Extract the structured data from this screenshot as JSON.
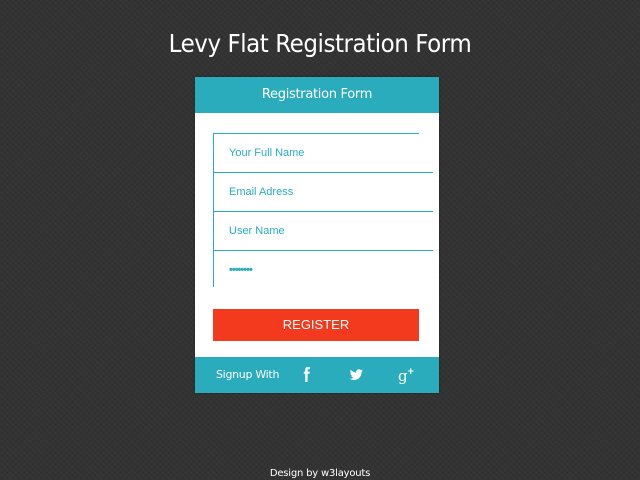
{
  "page": {
    "title": "Levy Flat Registration Form",
    "credit": "Design by w3layouts"
  },
  "form": {
    "header": "Registration Form",
    "fields": [
      {
        "placeholder": "Your Full Name"
      },
      {
        "placeholder": "Email Adress"
      },
      {
        "placeholder": "User Name"
      },
      {
        "value": "••••••••"
      }
    ],
    "register_label": "REGISTER",
    "footer": {
      "signup_label": "Signup With",
      "social": [
        "facebook-icon",
        "twitter-icon",
        "google-plus-icon"
      ]
    }
  },
  "colors": {
    "background": "#333333",
    "accent": "#2aacbc",
    "register_button": "#f33a1f",
    "card": "#ffffff"
  }
}
